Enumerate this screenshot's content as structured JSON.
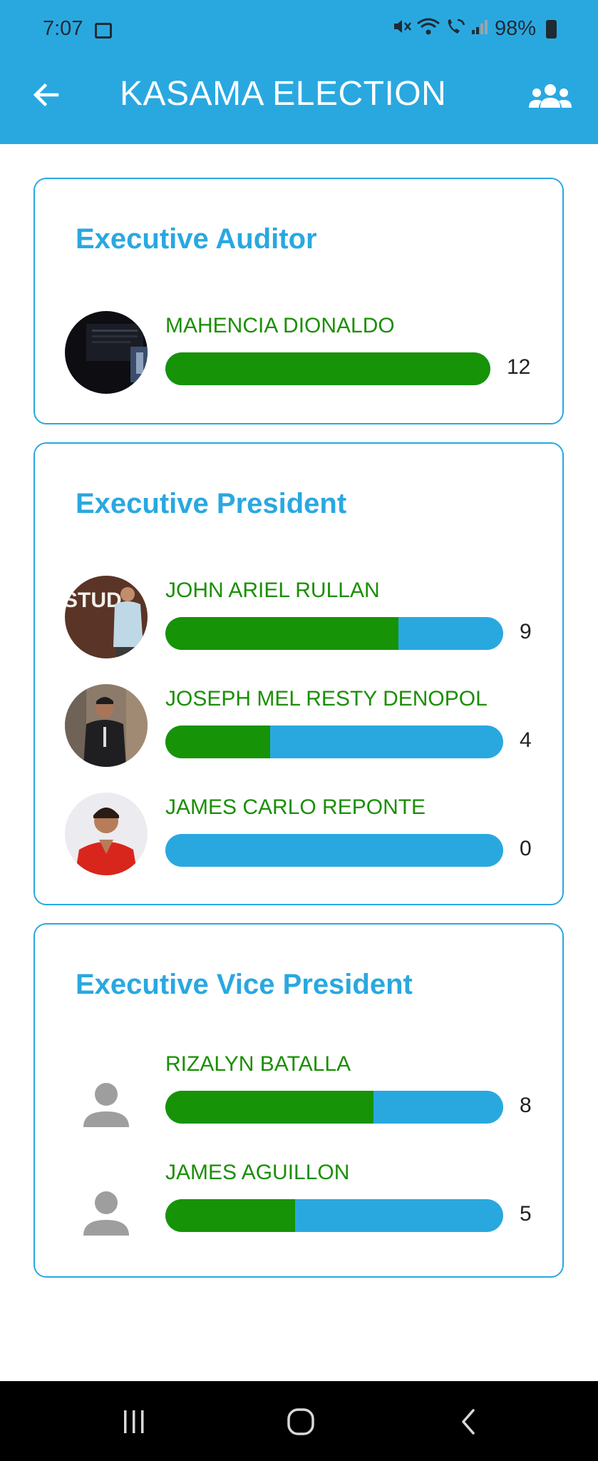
{
  "status_bar": {
    "time": "7:07",
    "battery": "98%"
  },
  "app_bar": {
    "title": "KASAMA ELECTION",
    "back_icon": "arrow-left-icon",
    "action_icon": "group-icon",
    "color": "#29a8e0"
  },
  "colors": {
    "votes_fill": "#179307",
    "bar_bg": "#29a8e0",
    "name_text": "#1a8f05"
  },
  "positions": [
    {
      "title": "Executive Auditor",
      "candidates": [
        {
          "name": "MAHENCIA DIONALDO",
          "votes": "12",
          "share": 1.0,
          "avatar": "photo"
        }
      ]
    },
    {
      "title": "Executive President",
      "candidates": [
        {
          "name": "JOHN ARIEL RULLAN",
          "votes": "9",
          "share": 0.69,
          "avatar": "photo"
        },
        {
          "name": "JOSEPH MEL RESTY DENOPOL",
          "votes": "4",
          "share": 0.31,
          "avatar": "photo"
        },
        {
          "name": "JAMES CARLO REPONTE",
          "votes": "0",
          "share": 0.0,
          "avatar": "photo"
        }
      ]
    },
    {
      "title": "Executive Vice President",
      "candidates": [
        {
          "name": "RIZALYN BATALLA",
          "votes": "8",
          "share": 0.615,
          "avatar": "person-icon"
        },
        {
          "name": "JAMES AGUILLON",
          "votes": "5",
          "share": 0.385,
          "avatar": "person-icon"
        }
      ]
    }
  ],
  "nav_bar": {
    "recents_icon": "recents-icon",
    "home_icon": "home-icon",
    "back_icon": "back-chevron-icon"
  }
}
